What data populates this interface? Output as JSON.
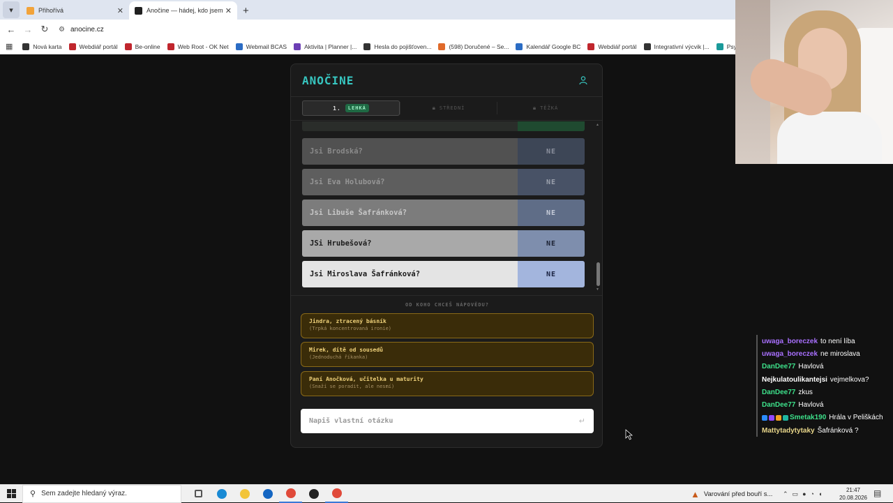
{
  "browser": {
    "tabs": [
      {
        "title": "Přihořívá",
        "favicon_color": "#f2a33a",
        "active": false
      },
      {
        "title": "Anočine — hádej, kdo jsem",
        "favicon_color": "#202020",
        "active": true
      }
    ],
    "url": "anocine.cz",
    "bookmarks": [
      {
        "label": "Nová karta",
        "color": "#333333"
      },
      {
        "label": "Webdiář portál",
        "color": "#c0262d"
      },
      {
        "label": "Be-online",
        "color": "#c0262d"
      },
      {
        "label": "Web Root - OK Net",
        "color": "#c0262d"
      },
      {
        "label": "Webmail BCAS",
        "color": "#2b6cc4"
      },
      {
        "label": "Aktivita | Planner |...",
        "color": "#6c3fb5"
      },
      {
        "label": "Hesla do pojišťoven...",
        "color": "#333333"
      },
      {
        "label": "(598) Doručené – Se...",
        "color": "#e06a2a"
      },
      {
        "label": "Kalendář Google BC",
        "color": "#2b6cc4"
      },
      {
        "label": "Webdiář portál",
        "color": "#c0262d"
      },
      {
        "label": "Integrativní výcvik |...",
        "color": "#333333"
      },
      {
        "label": "Psychoterap",
        "color": "#1a9a9a"
      }
    ]
  },
  "app": {
    "logo": "ANOČINE",
    "levels": [
      {
        "num": "1.",
        "label": "LEHKÁ",
        "active": true,
        "locked": false
      },
      {
        "num": "",
        "label": "STŘEDNÍ",
        "active": false,
        "locked": true
      },
      {
        "num": "",
        "label": "TĚŽKÁ",
        "active": false,
        "locked": true
      }
    ],
    "questions": [
      {
        "text": "",
        "answer": "",
        "bg": "#2a2d2a",
        "ansbg": "#1f4a30",
        "fg": "#666666",
        "afg": "#666666"
      },
      {
        "text": "Jsi Brodská?",
        "answer": "NE",
        "bg": "#515151",
        "ansbg": "#3d4656",
        "fg": "#8a8a8a",
        "afg": "#8a8f9c"
      },
      {
        "text": "Jsi Eva Holubová?",
        "answer": "NE",
        "bg": "#5e5e5e",
        "ansbg": "#485266",
        "fg": "#969696",
        "afg": "#9aa0ac"
      },
      {
        "text": "Jsi Libuše Šafránková?",
        "answer": "NE",
        "bg": "#7c7c7c",
        "ansbg": "#5f6d87",
        "fg": "#c7c7c7",
        "afg": "#c5cbd8"
      },
      {
        "text": "JSi Hrubešová?",
        "answer": "NE",
        "bg": "#a9a9a9",
        "ansbg": "#7e8ead",
        "fg": "#1c1c1c",
        "afg": "#1c2233"
      },
      {
        "text": "Jsi Miroslava Šafránková?",
        "answer": "NE",
        "bg": "#e4e4e4",
        "ansbg": "#a3b5dd",
        "fg": "#1a1a1a",
        "afg": "#1a2240"
      }
    ],
    "hint_title": "OD KOHO CHCEŠ NÁPOVĚDU?",
    "hints": [
      {
        "name": "Jindra, ztracený básník",
        "sub": "(Trpká koncentrovaná ironie)"
      },
      {
        "name": "Mirek, dítě od sousedů",
        "sub": "(Jednoduchá říkanka)"
      },
      {
        "name": "Paní Anočková, učitelka u maturity",
        "sub": "(Snaží se poradit, ale nesmí)"
      }
    ],
    "ask_placeholder": "Napiš vlastní otázku",
    "accent": "#37c6c0"
  },
  "chat": [
    {
      "user": "uwaga_boreczek",
      "color": "#a970ff",
      "text": "to není líba",
      "badges": []
    },
    {
      "user": "uwaga_boreczek",
      "color": "#a970ff",
      "text": "ne miroslava",
      "badges": []
    },
    {
      "user": "DanDee77",
      "color": "#3de08a",
      "text": "Havlová",
      "badges": []
    },
    {
      "user": "Nejkulatoulikantejsi",
      "color": "#ffffff",
      "text": "vejmelkova?",
      "badges": []
    },
    {
      "user": "DanDee77",
      "color": "#3de08a",
      "text": "zkus",
      "badges": []
    },
    {
      "user": "DanDee77",
      "color": "#3de08a",
      "text": "Havlová",
      "badges": []
    },
    {
      "user": "Smetak190",
      "color": "#3de08a",
      "text": "Hrála v Peliškách",
      "badges": [
        "#2b8cff",
        "#9147ff",
        "#f0a020",
        "#1fb6a0"
      ]
    },
    {
      "user": "Mattytadytytaky",
      "color": "#e8d68a",
      "text": "Šafránková ?",
      "badges": []
    }
  ],
  "taskbar": {
    "search_placeholder": "Sem zadejte hledaný výraz.",
    "apps": [
      {
        "name": "task-view",
        "color": "#555555"
      },
      {
        "name": "edge",
        "color": "#1a8ad4"
      },
      {
        "name": "explorer",
        "color": "#f2c43a"
      },
      {
        "name": "outlook",
        "color": "#1466c2"
      },
      {
        "name": "chrome",
        "color": "#e04a3a"
      },
      {
        "name": "app-red",
        "color": "#222222"
      },
      {
        "name": "chrome-2",
        "color": "#e04a3a"
      }
    ],
    "weather_alert": "Varování před bouří s...",
    "time": "21:47",
    "date": "20.08.2026"
  }
}
